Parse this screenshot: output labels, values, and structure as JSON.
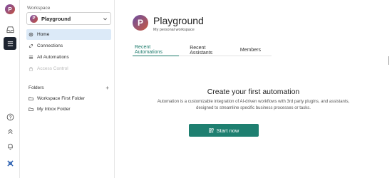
{
  "rail": {
    "avatar_initial": "P",
    "icons": [
      "inbox-icon",
      "list-icon",
      "help-icon",
      "chevrons-up-icon",
      "bell-icon",
      "logo-icon"
    ]
  },
  "sidebar": {
    "workspace_label": "Workspace",
    "workspace": {
      "initial": "P",
      "name": "Playground"
    },
    "nav": [
      {
        "label": "Home",
        "icon": "gear-icon",
        "active": true
      },
      {
        "label": "Connections",
        "icon": "link-icon"
      },
      {
        "label": "All Automations",
        "icon": "list-icon"
      },
      {
        "label": "Access Control",
        "icon": "lock-icon",
        "disabled": true
      }
    ],
    "folders_label": "Folders",
    "add_folder_glyph": "+",
    "folders": [
      {
        "label": "Workspace First Folder",
        "icon": "folder-icon"
      },
      {
        "label": "My Inbox Folder",
        "icon": "folder-icon"
      }
    ]
  },
  "main": {
    "avatar_initial": "P",
    "title": "Playground",
    "subtitle": "My personal workspace",
    "tabs": [
      {
        "label": "Recent Automations",
        "active": true
      },
      {
        "label": "Recent Assistants"
      },
      {
        "label": "Members"
      }
    ],
    "empty": {
      "title": "Create your first automation",
      "line1": "Automation is a customizable integration of AI-driven workflows with 3rd party plugins, and assistants,",
      "line2": "designed to streamline specific business processes or tasks.",
      "button_label": "Start now"
    }
  },
  "colors": {
    "accent": "#1e7f70",
    "active_nav": "#dceaf8",
    "rail_active": "#1d2430"
  }
}
